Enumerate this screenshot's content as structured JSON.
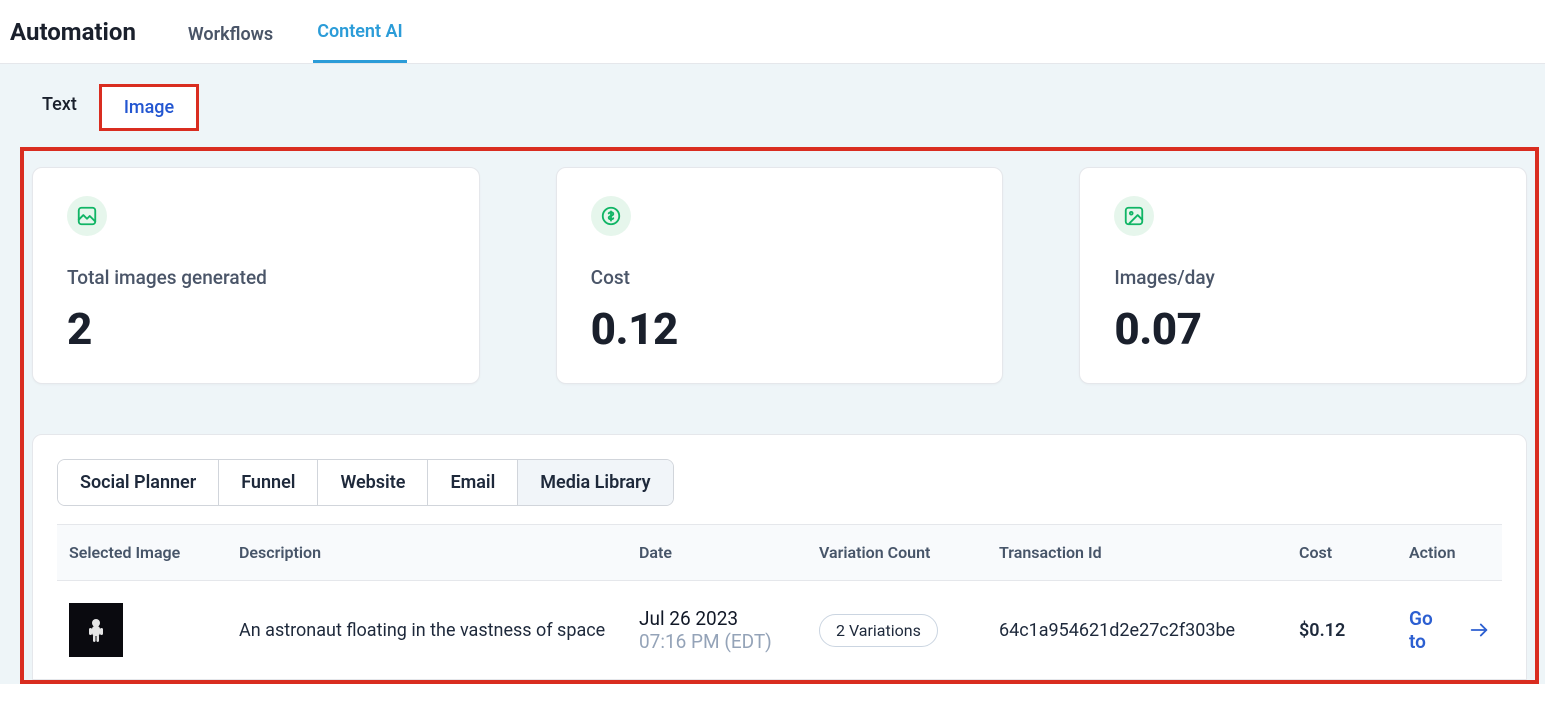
{
  "header": {
    "title": "Automation",
    "tabs": [
      {
        "label": "Workflows",
        "active": false
      },
      {
        "label": "Content AI",
        "active": true
      }
    ]
  },
  "subTabs": [
    {
      "label": "Text",
      "active": false
    },
    {
      "label": "Image",
      "active": true
    }
  ],
  "stats": [
    {
      "icon": "image-icon",
      "label": "Total images generated",
      "value": "2"
    },
    {
      "icon": "dollar-icon",
      "label": "Cost",
      "value": "0.12"
    },
    {
      "icon": "picture-icon",
      "label": "Images/day",
      "value": "0.07"
    }
  ],
  "filterTabs": [
    {
      "label": "Social Planner",
      "active": false
    },
    {
      "label": "Funnel",
      "active": false
    },
    {
      "label": "Website",
      "active": false
    },
    {
      "label": "Email",
      "active": false
    },
    {
      "label": "Media Library",
      "active": true
    }
  ],
  "table": {
    "columns": {
      "selectedImage": "Selected Image",
      "description": "Description",
      "date": "Date",
      "variationCount": "Variation Count",
      "transactionId": "Transaction Id",
      "cost": "Cost",
      "action": "Action"
    },
    "rows": [
      {
        "description": "An astronaut floating in the vastness of space",
        "dateLine1": "Jul 26 2023",
        "dateLine2": "07:16 PM (EDT)",
        "variationBadge": "2 Variations",
        "transactionId": "64c1a954621d2e27c2f303be",
        "cost": "$0.12",
        "actionLabel": "Go to"
      }
    ]
  }
}
